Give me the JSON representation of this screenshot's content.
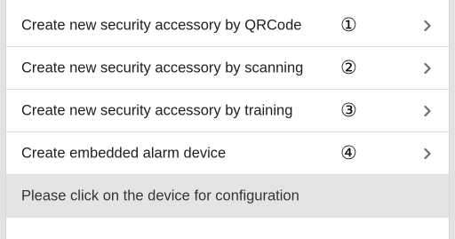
{
  "menu": {
    "items": [
      {
        "label": "Create new security accessory by QRCode",
        "marker": "①"
      },
      {
        "label": "Create new security accessory by scanning",
        "marker": "②"
      },
      {
        "label": "Create new security accessory by training",
        "marker": "③"
      },
      {
        "label": "Create embedded alarm device",
        "marker": "④"
      }
    ]
  },
  "info": {
    "text": "Please click on the device for configuration"
  },
  "colors": {
    "background": "#e2e2e2",
    "panel": "#ffffff",
    "text": "#1e1e1e",
    "chevron": "#6e6e6e",
    "info_bar": "#e4e4e4"
  },
  "icons": {
    "row_arrow": "chevron-right-icon"
  }
}
